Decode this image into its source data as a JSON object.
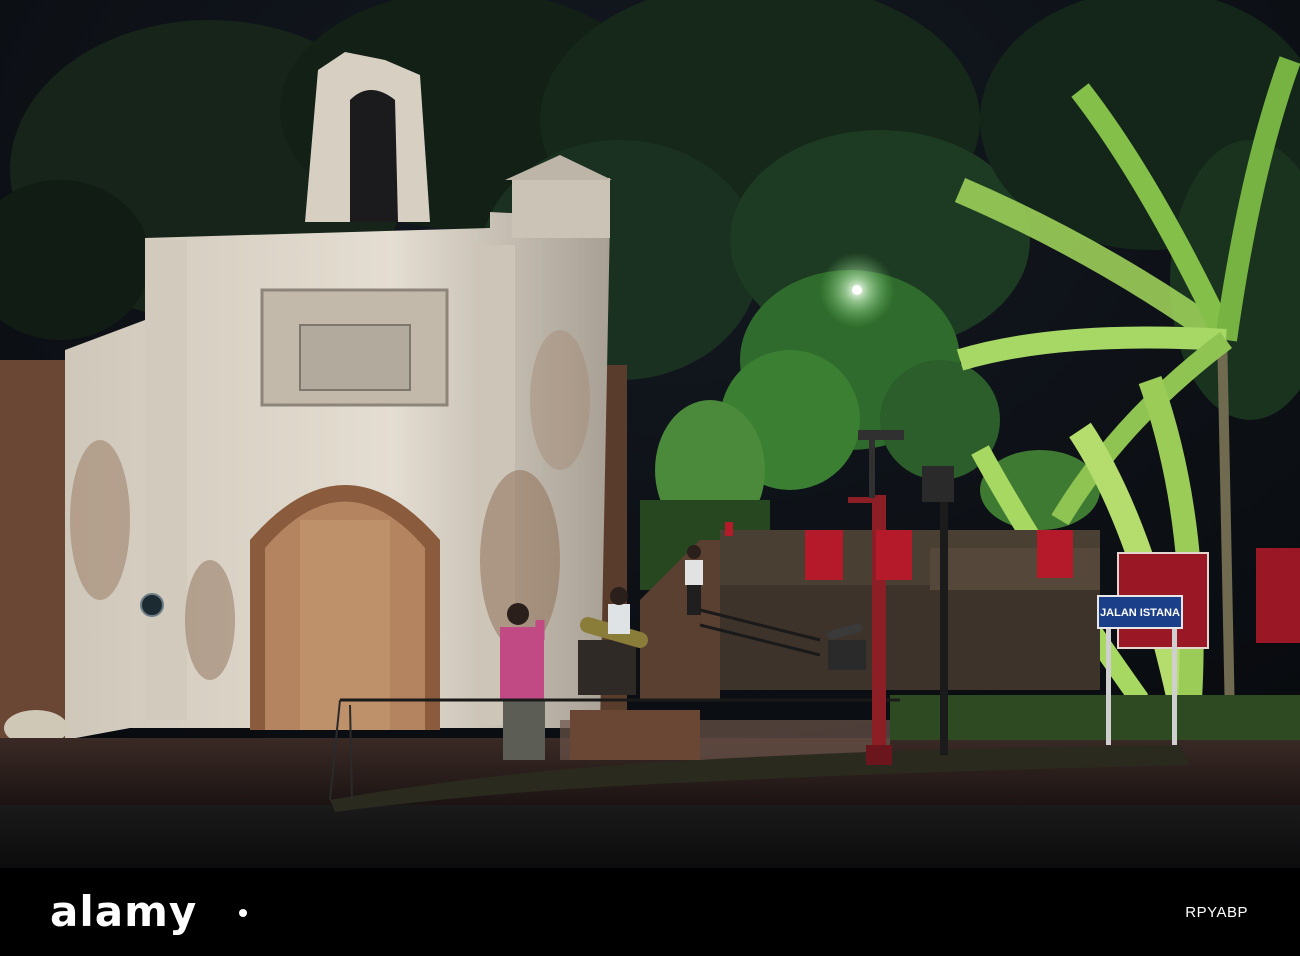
{
  "photo": {
    "description_id": "fort-gate-night-scene",
    "street_sign": {
      "title": "JALAN ISTANA"
    }
  },
  "footer": {
    "brand": "alamy",
    "image_id": "RPYABP"
  },
  "colors": {
    "sky": "#0b1016",
    "wall": "#d9d2c6",
    "brick": "#7a4a33",
    "foliage": "#1f4a22",
    "sign_red": "#b41a2a",
    "sign_blue": "#1c3f8a",
    "footer_bg": "#000000"
  }
}
